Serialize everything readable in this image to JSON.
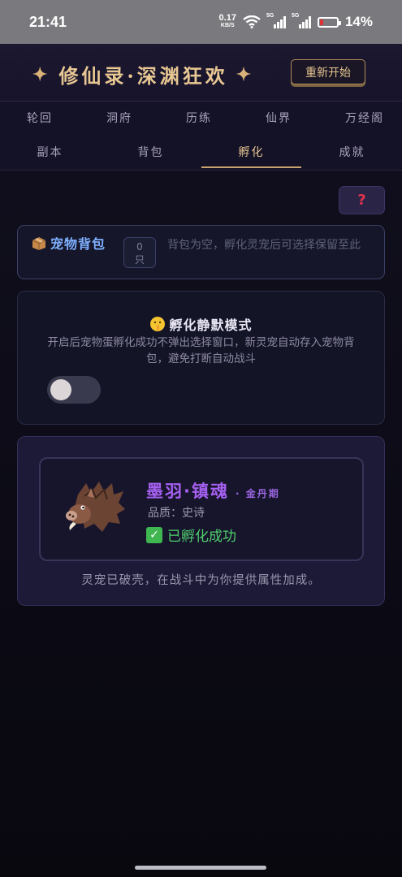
{
  "status_bar": {
    "time": "21:41",
    "net_speed": "0.17",
    "net_unit": "KB/S",
    "sim1": "5G",
    "sim2": "5G",
    "battery": "14%"
  },
  "header": {
    "title": "修仙录·深渊狂欢",
    "restart_label": "重新开始"
  },
  "nav": {
    "row1": [
      "轮回",
      "洞府",
      "历练",
      "仙界",
      "万经阁"
    ],
    "row2": [
      "副本",
      "背包",
      "孵化",
      "成就"
    ],
    "active_tab": "孵化"
  },
  "help_button": {
    "icon": "question-icon",
    "glyph": "?",
    "color": "#e0334f"
  },
  "pet_bag": {
    "icon": "package-icon",
    "label": "宠物背包",
    "count_value": "0",
    "count_unit": "只",
    "empty_text": "背包为空，孵化灵宠后可选择保留至此"
  },
  "silent_mode": {
    "icon": "shushing-face-icon",
    "title": "孵化静默模式",
    "description": "开启后宠物蛋孵化成功不弹出选择窗口，新灵宠自动存入宠物背包，避免打断自动战斗",
    "enabled": false
  },
  "hatch_result": {
    "pet_icon": "boar-icon",
    "pet_name": "墨羽·镇魂",
    "realm": "· 金丹期",
    "quality": "品质：史诗",
    "status_icon": "check-mark-icon",
    "status": "已孵化成功",
    "note": "灵宠已破壳，在战斗中为你提供属性加成。"
  },
  "colors": {
    "accent_gold": "#e8c792",
    "epic_purple": "#a560f0",
    "success_green": "#4fd06d",
    "bag_blue": "#7fb0ff"
  }
}
